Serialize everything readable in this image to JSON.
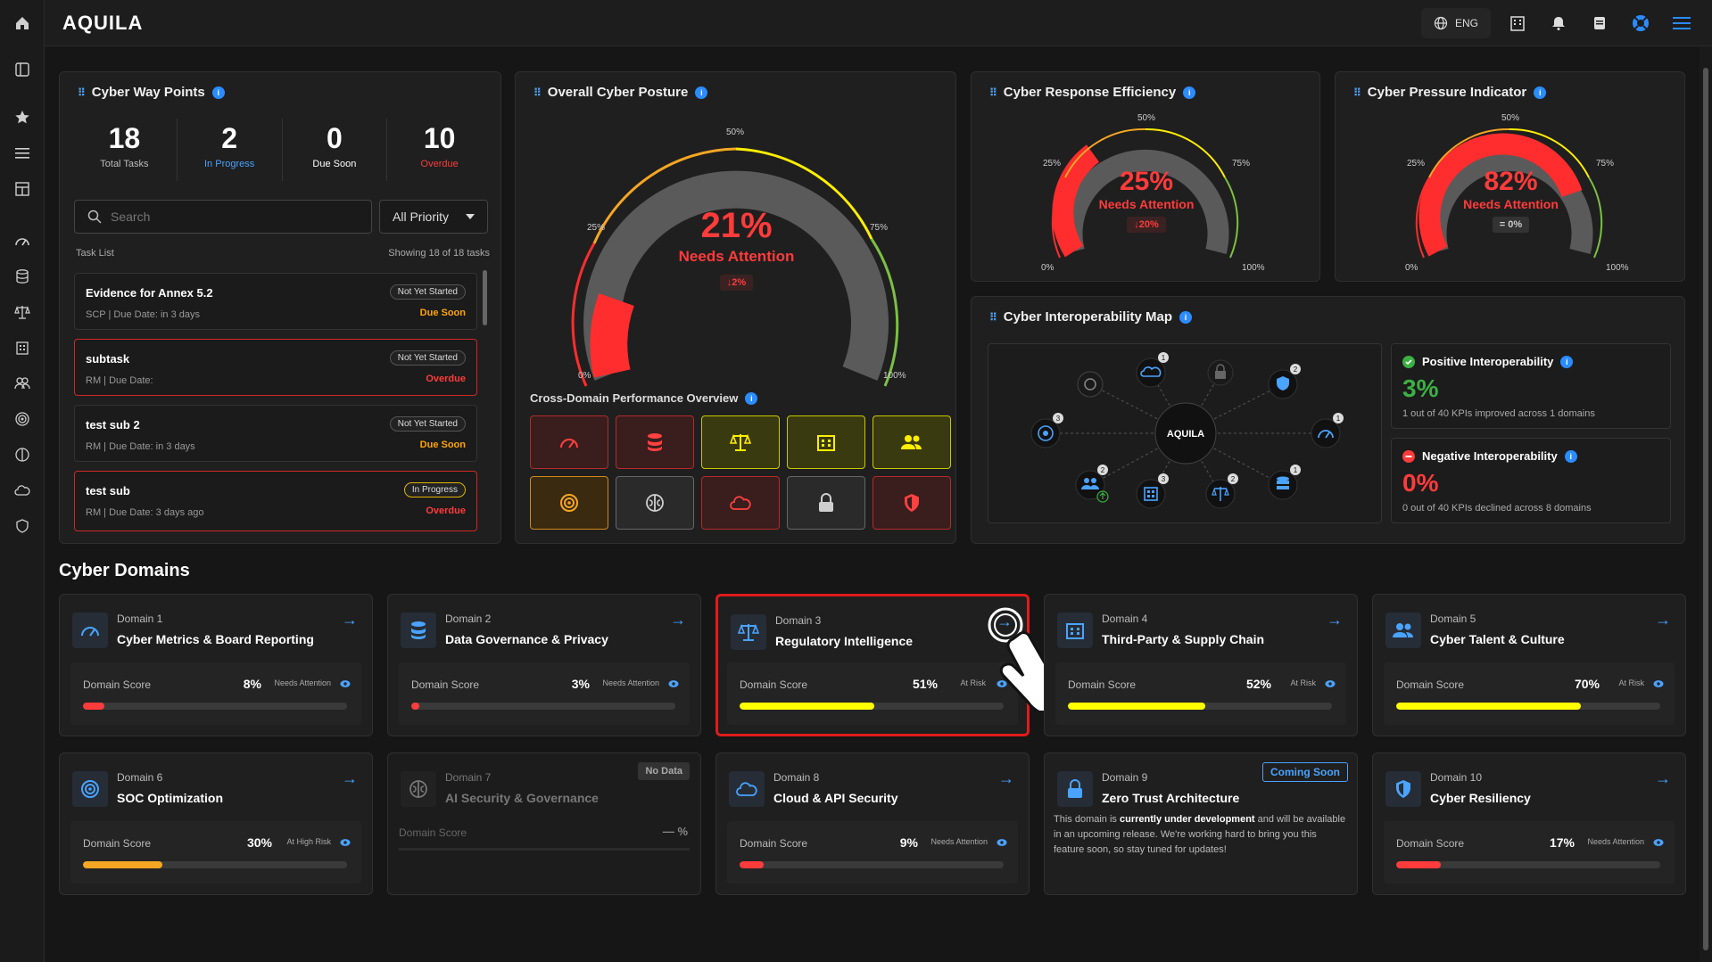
{
  "app": {
    "logo": "AQUILA",
    "lang": "ENG"
  },
  "waypoints": {
    "title": "Cyber Way Points",
    "stats": [
      {
        "num": "18",
        "label": "Total Tasks",
        "color": "#bbbbbb"
      },
      {
        "num": "2",
        "label": "In Progress",
        "color": "#4aa3ff"
      },
      {
        "num": "0",
        "label": "Due Soon",
        "color": "#ffffff"
      },
      {
        "num": "10",
        "label": "Overdue",
        "color": "#ff3b3b"
      }
    ],
    "search_placeholder": "Search",
    "priority": "All Priority",
    "tasklist_label": "Task List",
    "tasklist_count": "Showing 18 of 18 tasks",
    "tasks": [
      {
        "name": "Evidence for Annex 5.2",
        "meta": "SCP | Due Date: in 3 days",
        "badge": "Not Yet Started",
        "due": "Due Soon",
        "due_color": "#ffa500",
        "overdue": false
      },
      {
        "name": "subtask",
        "meta": "RM | Due Date:",
        "badge": "Not Yet Started",
        "due": "Overdue",
        "due_color": "#ff3b3b",
        "overdue": true
      },
      {
        "name": "test sub 2",
        "meta": "RM | Due Date: in 3 days",
        "badge": "Not Yet Started",
        "due": "Due Soon",
        "due_color": "#ffa500",
        "overdue": false
      },
      {
        "name": "test sub",
        "meta": "RM | Due Date: 3 days ago",
        "badge": "In Progress",
        "due": "Overdue",
        "due_color": "#ff3b3b",
        "overdue": true
      }
    ]
  },
  "posture": {
    "title": "Overall Cyber Posture",
    "value": "21%",
    "status": "Needs Attention",
    "delta": "↓2%",
    "ticks": {
      "t0": "0%",
      "t25": "25%",
      "t50": "50%",
      "t75": "75%",
      "t100": "100%"
    },
    "perf_title": "Cross-Domain Performance Overview"
  },
  "response": {
    "title": "Cyber Response Efficiency",
    "value": "25%",
    "status": "Needs Attention",
    "delta": "↓20%"
  },
  "pressure": {
    "title": "Cyber Pressure Indicator",
    "value": "82%",
    "status": "Needs Attention",
    "delta": "= 0%"
  },
  "interop": {
    "title": "Cyber Interoperability Map",
    "center": "AQUILA",
    "positive_title": "Positive Interoperability",
    "positive_value": "3%",
    "positive_desc": "1 out of 40 KPIs improved across 1 domains",
    "negative_title": "Negative Interoperability",
    "negative_value": "0%",
    "negative_desc": "0 out of 40 KPIs declined across 8 domains",
    "counts": {
      "cloud": "1",
      "shield": "2",
      "gauge": "1",
      "db": "1",
      "scale": "2",
      "building": "3",
      "people": "2",
      "target": "3"
    }
  },
  "domains_title": "Cyber Domains",
  "domains": [
    {
      "num": "Domain 1",
      "name": "Cyber Metrics & Board Reporting",
      "label": "Domain Score",
      "score": "8%",
      "status": "Needs Attention",
      "fill": 8,
      "color": "#ff3b3b"
    },
    {
      "num": "Domain 2",
      "name": "Data Governance & Privacy",
      "label": "Domain Score",
      "score": "3%",
      "status": "Needs Attention",
      "fill": 3,
      "color": "#ff3b3b"
    },
    {
      "num": "Domain 3",
      "name": "Regulatory Intelligence",
      "label": "Domain Score",
      "score": "51%",
      "status": "At Risk",
      "fill": 51,
      "color": "#ffff00"
    },
    {
      "num": "Domain 4",
      "name": "Third-Party & Supply Chain",
      "label": "Domain Score",
      "score": "52%",
      "status": "At Risk",
      "fill": 52,
      "color": "#ffff00"
    },
    {
      "num": "Domain 5",
      "name": "Cyber Talent & Culture",
      "label": "Domain Score",
      "score": "70%",
      "status": "At Risk",
      "fill": 70,
      "color": "#ffff00"
    },
    {
      "num": "Domain 6",
      "name": "SOC Optimization",
      "label": "Domain Score",
      "score": "30%",
      "status": "At High Risk",
      "fill": 30,
      "color": "#f5a623"
    },
    {
      "num": "Domain 7",
      "name": "AI Security & Governance",
      "label": "Domain Score",
      "score": "— %",
      "badge": "No Data"
    },
    {
      "num": "Domain 8",
      "name": "Cloud & API Security",
      "label": "Domain Score",
      "score": "9%",
      "status": "Needs Attention",
      "fill": 9,
      "color": "#ff3b3b"
    },
    {
      "num": "Domain 9",
      "name": "Zero Trust Architecture",
      "badge": "Coming Soon",
      "desc_pre": "This domain is ",
      "desc_bold": "currently under development",
      "desc_post": " and will be available in an upcoming release. We're working hard to bring you this feature soon, so stay tuned for updates!"
    },
    {
      "num": "Domain 10",
      "name": "Cyber Resiliency",
      "label": "Domain Score",
      "score": "17%",
      "status": "Needs Attention",
      "fill": 17,
      "color": "#ff3b3b"
    }
  ]
}
